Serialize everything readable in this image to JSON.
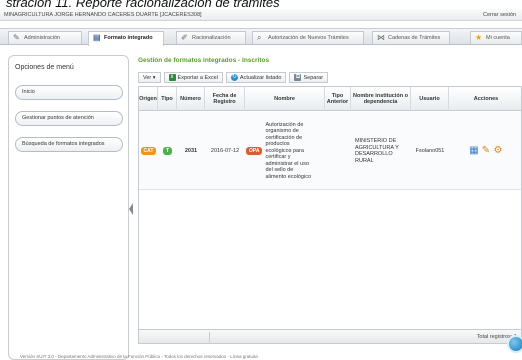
{
  "caption": "stración 11. Reporte racionalización de trámites",
  "topbar": {
    "user": "MINAGRICULTURA JORGE HERNANDO CACERES DUARTE [JCACERES308]",
    "logout": "Cerrar sesión"
  },
  "tabs": [
    {
      "label": "Administración",
      "icon": "wrench-icon"
    },
    {
      "label": "Formato integrado",
      "icon": "form-icon",
      "active": true
    },
    {
      "label": "Racionalización",
      "icon": "edit-icon"
    },
    {
      "label": "Autorización de Nuevos Trámites",
      "icon": "search-icon"
    },
    {
      "label": "Cadenas de Trámites",
      "icon": "share-icon"
    },
    {
      "label": "Mi cuenta",
      "icon": "star-icon"
    }
  ],
  "sidebar": {
    "title": "Opciones de menú",
    "items": [
      "Inicio",
      "Gestionar puntos de atención",
      "Búsqueda de formatos integrados"
    ]
  },
  "main": {
    "title": "Gestión de formatos integrados - Inscritos",
    "toolbar": {
      "view": "Ver ▾",
      "export": "Exportar a Excel",
      "refresh": "Actualizar listado",
      "detach": "Separar"
    },
    "columns": [
      "Origen",
      "Tipo",
      "Número",
      "Fecha de Registro",
      "Nombre",
      "Tipo Anterior",
      "Nombre institución o dependencia",
      "Usuario",
      "Acciones"
    ],
    "rows": [
      {
        "origen_badge": "CAT",
        "tipo_badge": "T",
        "numero": "2031",
        "fecha": "2016-07-12",
        "nombre_badge": "OPA",
        "nombre": "Autorización de organismo de certificación de productos ecológicos para certificar y administrar el uso del sello de alimento ecológico",
        "tipo_anterior": "",
        "institucion": "MINISTERIO DE AGRICULTURA Y DESARROLLO RURAL",
        "usuario": "Fsolano051"
      }
    ],
    "footer_total": "Total registros: 1"
  },
  "bottom_text": "Versión SUIT 3.0 - Departamento Administrativo de la Función Pública - Todos los derechos reservados - Línea gratuita",
  "colors": {
    "accent_green": "#5a9a2e",
    "badge_orange": "#f0921e",
    "badge_green": "#4caf50",
    "badge_red": "#e25b2a"
  }
}
